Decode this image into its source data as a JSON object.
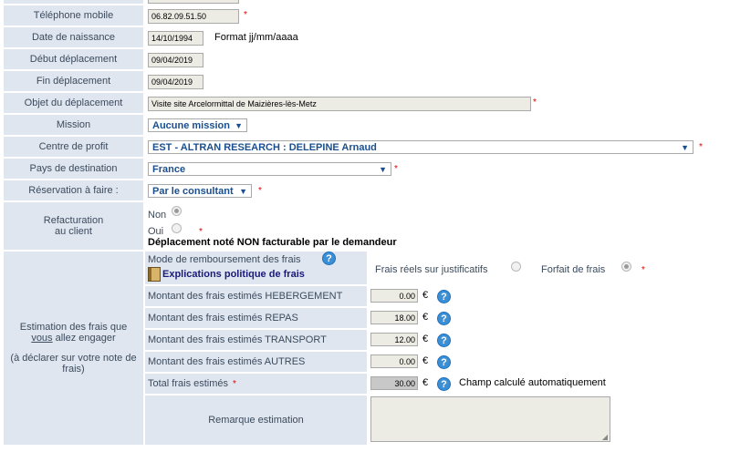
{
  "fields": {
    "telephone": {
      "label": "Téléphone mobile",
      "value": "06.82.09.51.50"
    },
    "naissance": {
      "label": "Date de naissance",
      "value": "14/10/1994",
      "hint": "Format jj/mm/aaaa"
    },
    "debut": {
      "label": "Début déplacement",
      "value": "09/04/2019"
    },
    "fin": {
      "label": "Fin déplacement",
      "value": "09/04/2019"
    },
    "objet": {
      "label": "Objet du déplacement",
      "value": "Visite site Arcelormittal de Maizières-lès-Metz"
    },
    "mission": {
      "label": "Mission",
      "value": "Aucune mission"
    },
    "centre": {
      "label": "Centre de profit",
      "value": "EST - ALTRAN RESEARCH : DELEPINE Arnaud"
    },
    "pays": {
      "label": "Pays de destination",
      "value": "France"
    },
    "reservation": {
      "label": "Réservation à faire :",
      "value": "Par le consultant"
    }
  },
  "refact": {
    "label1": "Refacturation",
    "label2": "au client",
    "non": "Non",
    "oui": "Oui",
    "note": "Déplacement noté NON facturable par le demandeur",
    "selected": "non"
  },
  "estimation": {
    "label_l1": "Estimation des frais que",
    "label_l2_u": "vous",
    "label_l2_rest": " allez engager",
    "label_l3": "(à déclarer sur votre note de",
    "label_l4": "frais)",
    "mode_label": "Mode de remboursement des frais",
    "explications": "Explications politique de frais",
    "opt_reels": "Frais réels sur justificatifs",
    "opt_forfait": "Forfait de frais",
    "selected": "forfait",
    "currency": "€",
    "rows": [
      {
        "label": "Montant des frais estimés HEBERGEMENT",
        "value": "0.00"
      },
      {
        "label": "Montant des frais estimés REPAS",
        "value": "18.00"
      },
      {
        "label": "Montant des frais estimés TRANSPORT",
        "value": "12.00"
      },
      {
        "label": "Montant des frais estimés AUTRES",
        "value": "0.00"
      }
    ],
    "total_label": "Total frais estimés",
    "total_value": "30.00",
    "total_note": "Champ calculé automatiquement",
    "remarque_label": "Remarque estimation",
    "remarque_value": ""
  },
  "icons": {
    "help": "help-icon",
    "book": "book-icon"
  },
  "colors": {
    "label_bg": "#dfe6f0",
    "accent": "#1a4f8f",
    "required": "#e00000"
  }
}
